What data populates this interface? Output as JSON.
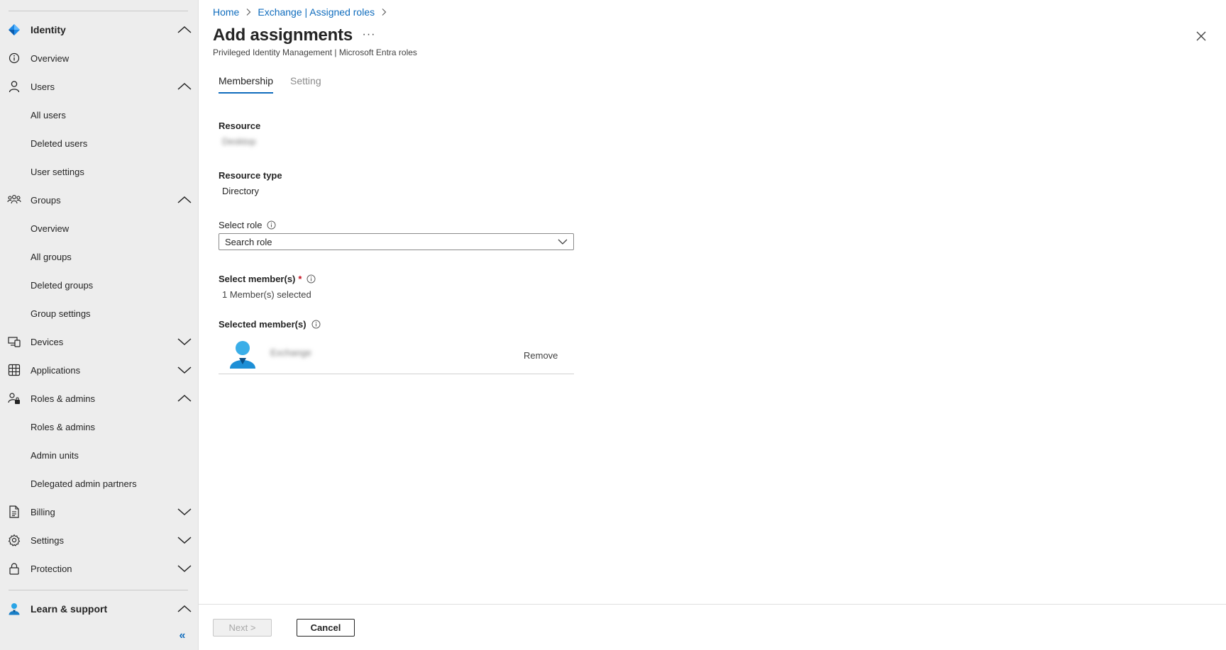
{
  "sidebar": {
    "items": [
      {
        "label": "Identity",
        "icon": "identity-diamond-icon",
        "chevron": "up"
      },
      {
        "label": "Overview",
        "icon": "info-circle-icon"
      },
      {
        "label": "Users",
        "icon": "person-icon",
        "chevron": "up"
      },
      {
        "label": "All users"
      },
      {
        "label": "Deleted users"
      },
      {
        "label": "User settings"
      },
      {
        "label": "Groups",
        "icon": "people-group-icon",
        "chevron": "up"
      },
      {
        "label": "Overview"
      },
      {
        "label": "All groups"
      },
      {
        "label": "Deleted groups"
      },
      {
        "label": "Group settings"
      },
      {
        "label": "Devices",
        "icon": "devices-icon",
        "chevron": "down"
      },
      {
        "label": "Applications",
        "icon": "apps-grid-icon",
        "chevron": "down"
      },
      {
        "label": "Roles & admins",
        "icon": "roles-admins-icon",
        "chevron": "up"
      },
      {
        "label": "Roles & admins"
      },
      {
        "label": "Admin units"
      },
      {
        "label": "Delegated admin partners"
      },
      {
        "label": "Billing",
        "icon": "billing-document-icon",
        "chevron": "down"
      },
      {
        "label": "Settings",
        "icon": "gear-icon",
        "chevron": "down"
      },
      {
        "label": "Protection",
        "icon": "lock-icon",
        "chevron": "down"
      },
      {
        "label": "Learn & support",
        "icon": "learn-support-person-icon",
        "chevron": "up"
      }
    ],
    "collapse_glyph": "«"
  },
  "breadcrumb": {
    "home": "Home",
    "parent": "Exchange | Assigned roles"
  },
  "page": {
    "title": "Add assignments",
    "more": "···",
    "subtitle": "Privileged Identity Management | Microsoft Entra roles"
  },
  "tabs": [
    {
      "label": "Membership",
      "active": true
    },
    {
      "label": "Setting",
      "active": false
    }
  ],
  "form": {
    "resource_label": "Resource",
    "resource_value": "Desktop",
    "resource_type_label": "Resource type",
    "resource_type_value": "Directory",
    "select_role_label": "Select role",
    "select_role_placeholder": "Search role",
    "select_members_label": "Select member(s)",
    "required_marker": "*",
    "members_selected": "1 Member(s) selected",
    "selected_members_label": "Selected member(s)",
    "member_name": "Exchange",
    "remove_label": "Remove"
  },
  "footer": {
    "next_label": "Next >",
    "cancel_label": "Cancel"
  },
  "colors": {
    "accent": "#0f6cbd",
    "required": "#c50f1f",
    "sidebar_bg": "#ededed"
  }
}
